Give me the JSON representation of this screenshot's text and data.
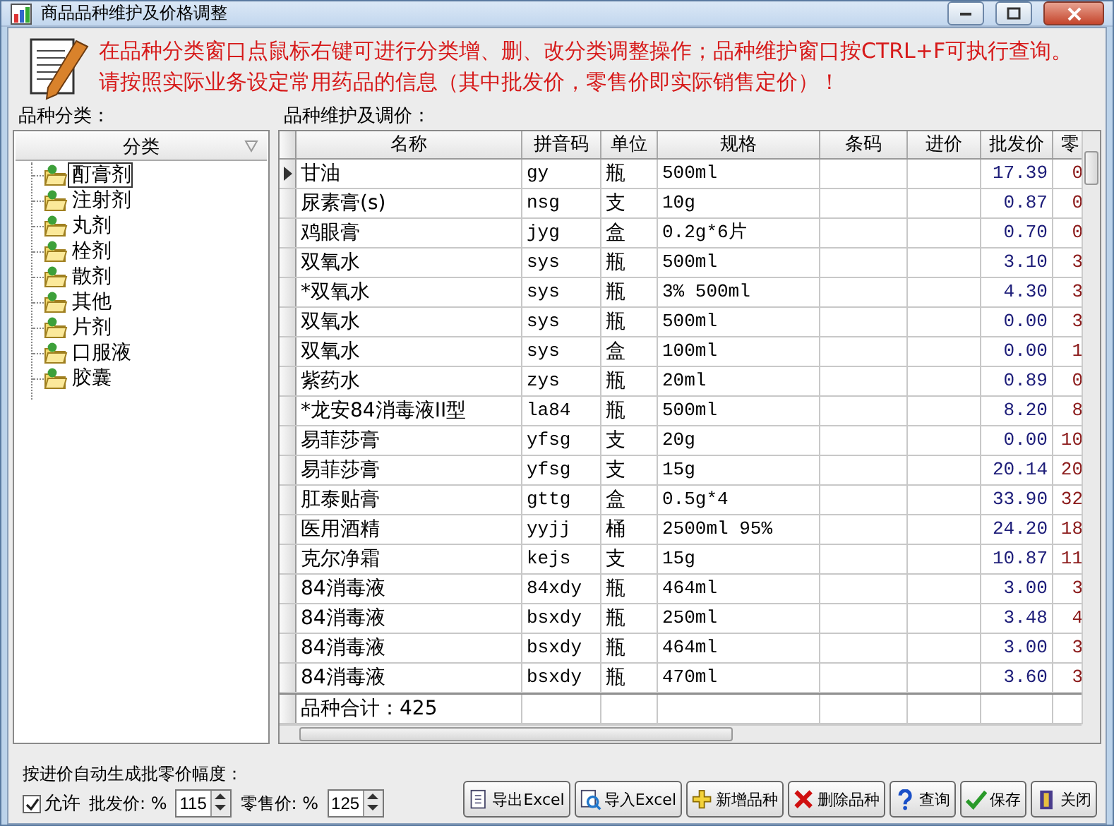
{
  "window": {
    "title": "商品品种维护及价格调整"
  },
  "banner": {
    "lines": [
      "在品种分类窗口点鼠标右键可进行分类增、删、改分类调整操作；品种维护窗口按CTRL+F可执行查询。",
      "请按照实际业务设定常用药品的信息（其中批发价，零售价即实际销售定价）！"
    ]
  },
  "categories": {
    "label": "品种分类：",
    "header": "分类",
    "items": [
      {
        "label": "酊膏剂",
        "selected": true
      },
      {
        "label": "注射剂",
        "selected": false
      },
      {
        "label": "丸剂",
        "selected": false
      },
      {
        "label": "栓剂",
        "selected": false
      },
      {
        "label": "散剂",
        "selected": false
      },
      {
        "label": "其他",
        "selected": false
      },
      {
        "label": "片剂",
        "selected": false
      },
      {
        "label": "口服液",
        "selected": false
      },
      {
        "label": "胶囊",
        "selected": false
      }
    ]
  },
  "products": {
    "label": "品种维护及调价：",
    "columns": [
      "名称",
      "拼音码",
      "单位",
      "规格",
      "条码",
      "进价",
      "批发价",
      "零"
    ],
    "rows": [
      {
        "selected": true,
        "cells": [
          "甘油",
          "gy",
          "瓶",
          "500ml",
          "",
          "",
          "17.39",
          "0"
        ]
      },
      {
        "selected": false,
        "cells": [
          "尿素膏(s)",
          "nsg",
          "支",
          "10g",
          "",
          "",
          "0.87",
          "0"
        ]
      },
      {
        "selected": false,
        "cells": [
          "鸡眼膏",
          "jyg",
          "盒",
          "0.2g*6片",
          "",
          "",
          "0.70",
          "0"
        ]
      },
      {
        "selected": false,
        "cells": [
          "双氧水",
          "sys",
          "瓶",
          "500ml",
          "",
          "",
          "3.10",
          "3"
        ]
      },
      {
        "selected": false,
        "cells": [
          "*双氧水",
          "sys",
          "瓶",
          "3% 500ml",
          "",
          "",
          "4.30",
          "3"
        ]
      },
      {
        "selected": false,
        "cells": [
          "双氧水",
          "sys",
          "瓶",
          "500ml",
          "",
          "",
          "0.00",
          "3"
        ]
      },
      {
        "selected": false,
        "cells": [
          "双氧水",
          "sys",
          "盒",
          "100ml",
          "",
          "",
          "0.00",
          "1"
        ]
      },
      {
        "selected": false,
        "cells": [
          "紫药水",
          "zys",
          "瓶",
          "20ml",
          "",
          "",
          "0.89",
          "0"
        ]
      },
      {
        "selected": false,
        "cells": [
          "*龙安84消毒液II型",
          "la84",
          "瓶",
          "500ml",
          "",
          "",
          "8.20",
          "8"
        ]
      },
      {
        "selected": false,
        "cells": [
          "易菲莎膏",
          "yfsg",
          "支",
          "20g",
          "",
          "",
          "0.00",
          "10"
        ]
      },
      {
        "selected": false,
        "cells": [
          "易菲莎膏",
          "yfsg",
          "支",
          "15g",
          "",
          "",
          "20.14",
          "20"
        ]
      },
      {
        "selected": false,
        "cells": [
          "肛泰贴膏",
          "gttg",
          "盒",
          "0.5g*4",
          "",
          "",
          "33.90",
          "32"
        ]
      },
      {
        "selected": false,
        "cells": [
          "医用酒精",
          "yyjj",
          "桶",
          "2500ml 95%",
          "",
          "",
          "24.20",
          "18"
        ]
      },
      {
        "selected": false,
        "cells": [
          "克尔净霜",
          "kejs",
          "支",
          "15g",
          "",
          "",
          "10.87",
          "11"
        ]
      },
      {
        "selected": false,
        "cells": [
          "84消毒液",
          "84xdy",
          "瓶",
          "464ml",
          "",
          "",
          "3.00",
          "3"
        ]
      },
      {
        "selected": false,
        "cells": [
          "84消毒液",
          "bsxdy",
          "瓶",
          "250ml",
          "",
          "",
          "3.48",
          "4"
        ]
      },
      {
        "selected": false,
        "cells": [
          "84消毒液",
          "bsxdy",
          "瓶",
          "464ml",
          "",
          "",
          "3.00",
          "3"
        ]
      },
      {
        "selected": false,
        "cells": [
          "84消毒液",
          "bsxdy",
          "瓶",
          "470ml",
          "",
          "",
          "3.60",
          "3"
        ]
      }
    ],
    "footer": "品种合计：425"
  },
  "pricing": {
    "label": "按进价自动生成批零价幅度：",
    "allow": {
      "label": "允许",
      "checked": true
    },
    "fields": [
      {
        "label": "批发价: %",
        "value": "115"
      },
      {
        "label": "零售价: %",
        "value": "125"
      }
    ]
  },
  "buttons": [
    {
      "kind": "export",
      "label": "导出Excel"
    },
    {
      "kind": "import",
      "label": "导入Excel"
    },
    {
      "kind": "add",
      "label": "新增品种"
    },
    {
      "kind": "delete",
      "label": "删除品种"
    },
    {
      "kind": "query",
      "label": "查询"
    },
    {
      "kind": "save",
      "label": "保存"
    },
    {
      "kind": "close",
      "label": "关闭"
    }
  ]
}
